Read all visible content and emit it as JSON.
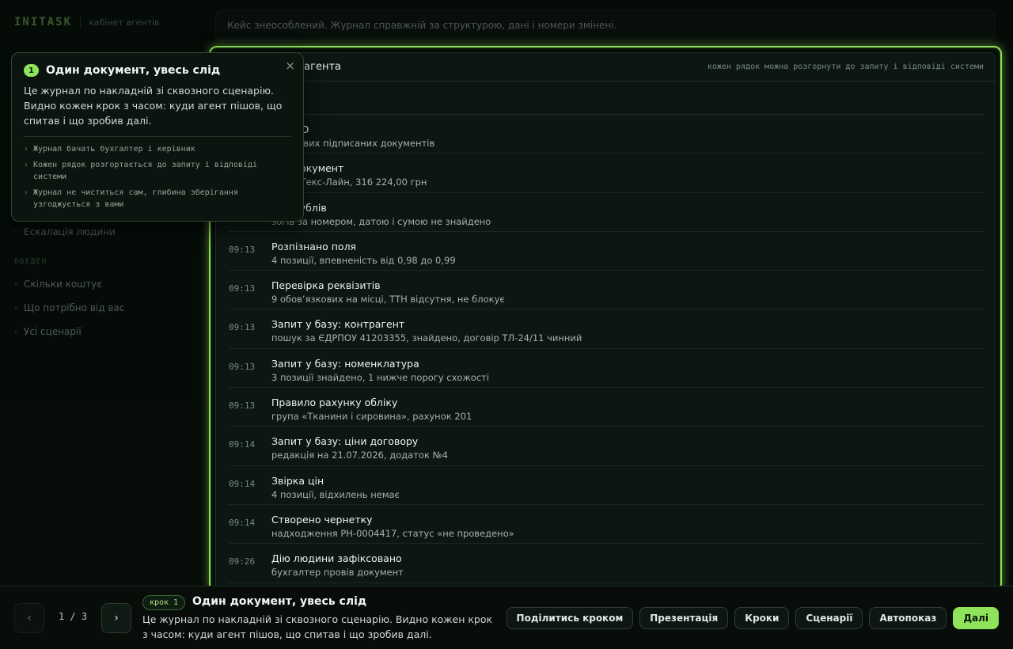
{
  "sidebar": {
    "brand": "INITASK",
    "brand_sub": "кабінет агентів",
    "partial_item": "Ескалація людини",
    "section_label": "ВВЕДЕН",
    "items": [
      {
        "label": "Скільки коштує"
      },
      {
        "label": "Що потрібно від вас"
      },
      {
        "label": "Усі сценарії"
      }
    ]
  },
  "top_note": "Кейс знеособлений. Журнал справжній за структурою, дані і номери змінені.",
  "journal": {
    "title": "дій агента",
    "hint": "кожен рядок можна розгорнути до запиту і відповіді системи",
    "rows": [
      {
        "time": "",
        "title": "но ЕДО",
        "desc": ": 28 нових підписаних документів"
      },
      {
        "time": "",
        "title": "ано документ",
        "desc": "4417, Текс-Лайн, 316 224,00 грн"
      },
      {
        "time": "",
        "title": "рка дублів",
        "desc": "зогів за номером, датою і сумою не знайдено"
      },
      {
        "time": "09:13",
        "title": "Розпізнано поля",
        "desc": "4 позиції, впевненість від 0,98 до 0,99"
      },
      {
        "time": "09:13",
        "title": "Перевірка реквізитів",
        "desc": "9 обов’язкових на місці, ТТН відсутня, не блокує"
      },
      {
        "time": "09:13",
        "title": "Запит у базу: контрагент",
        "desc": "пошук за ЄДРПОУ 41203355, знайдено, договір ТЛ-24/11 чинний"
      },
      {
        "time": "09:13",
        "title": "Запит у базу: номенклатура",
        "desc": "3 позиції знайдено, 1 нижче порогу схожості"
      },
      {
        "time": "09:13",
        "title": "Правило рахунку обліку",
        "desc": "група «Тканини і сировина», рахунок 201"
      },
      {
        "time": "09:14",
        "title": "Запит у базу: ціни договору",
        "desc": "редакція на 21.07.2026, додаток №4"
      },
      {
        "time": "09:14",
        "title": "Звірка цін",
        "desc": "4 позиції, відхилень немає"
      },
      {
        "time": "09:14",
        "title": "Створено чернетку",
        "desc": "надходження РН-0004417, статус «не проведено»"
      },
      {
        "time": "09:26",
        "title": "Дію людини зафіксовано",
        "desc": "бухгалтер провів документ"
      }
    ]
  },
  "popover": {
    "number": "1",
    "title": "Один документ, увесь слід",
    "text": "Це журнал по накладній зі сквозного сценарію. Видно кожен крок з часом: куди агент пішов, що спитав і що зробив далі.",
    "bullets": [
      "Журнал бачать бухгалтер і керівник",
      "Кожен рядок розгортається до запиту і відповіді системи",
      "Журнал не чиститься сам, глибина зберігання узгоджується з вами"
    ],
    "close": "×"
  },
  "bottom": {
    "prev": "‹",
    "next": "›",
    "counter": "1 / 3",
    "step_badge": "крок 1",
    "step_title": "Один документ, увесь слід",
    "step_text": "Це журнал по накладній зі сквозного сценарію. Видно кожен крок з часом: куди агент пішов, що спитав і що зробив далі.",
    "actions": {
      "share": "Поділитись кроком",
      "presentation": "Презентація",
      "steps": "Кроки",
      "scenarios": "Сценарії",
      "autoplay": "Автопоказ",
      "next": "Далі"
    }
  },
  "colors": {
    "accent": "#8fe35a",
    "background": "#050a07"
  }
}
